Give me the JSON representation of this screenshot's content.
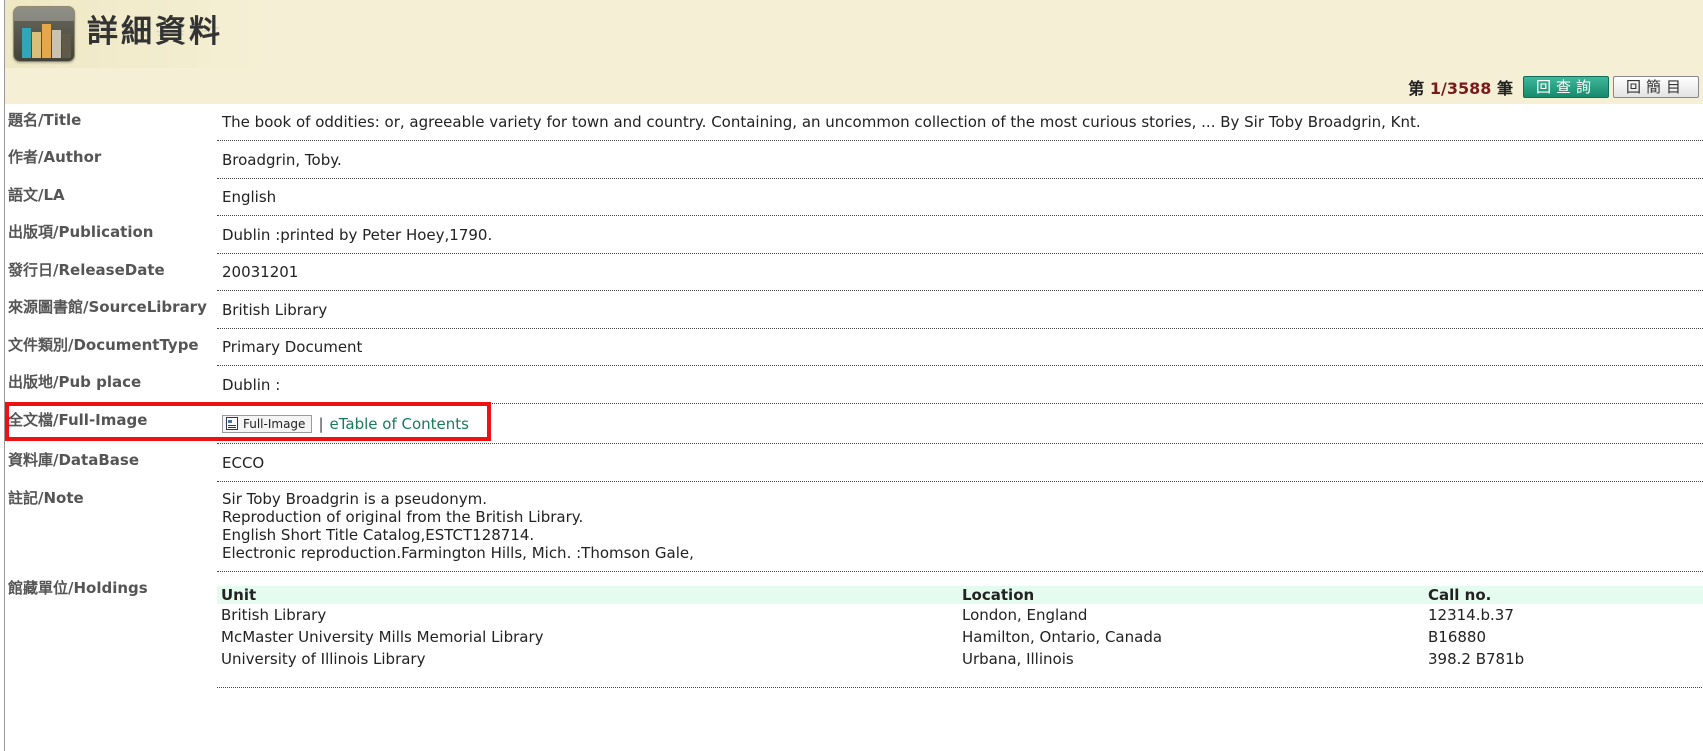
{
  "header": {
    "title": "詳細資料",
    "pager": {
      "prefix": "第",
      "current_total": "1/3588",
      "suffix": "筆"
    },
    "buttons": {
      "back_to_query": "回查詢",
      "back_to_list": "回簡目"
    }
  },
  "colors": {
    "header_bg": "#f5f0d5",
    "highlight_border": "#ee1111",
    "link": "#1b7a56",
    "table_header_bg": "#e6fbef"
  },
  "fields": {
    "title": {
      "label": "題名/Title",
      "value": "The book of oddities: or, agreeable variety for town and country. Containing, an uncommon collection of the most curious stories, ... By Sir Toby Broadgrin, Knt."
    },
    "author": {
      "label": "作者/Author",
      "value": "Broadgrin, Toby."
    },
    "language": {
      "label": "語文/LA",
      "value": "English"
    },
    "publication": {
      "label": "出版項/Publication",
      "value": "Dublin :printed by Peter Hoey,1790."
    },
    "release_date": {
      "label": "發行日/ReleaseDate",
      "value": "20031201"
    },
    "source_library": {
      "label": "來源圖書館/SourceLibrary",
      "value": "British Library"
    },
    "document_type": {
      "label": "文件類別/DocumentType",
      "value": "Primary Document"
    },
    "pub_place": {
      "label": "出版地/Pub place",
      "value": "Dublin :"
    },
    "full_image": {
      "label": "全文檔/Full-Image",
      "button": "Full-Image",
      "separator": "|",
      "link": "eTable of Contents",
      "icon": "document-icon"
    },
    "database": {
      "label": "資料庫/DataBase",
      "value": "ECCO"
    },
    "note": {
      "label": "註記/Note",
      "lines": [
        "Sir Toby Broadgrin is a pseudonym.",
        "Reproduction of original from the British Library.",
        "English Short Title Catalog,ESTCT128714.",
        "Electronic reproduction.Farmington Hills, Mich. :Thomson Gale,"
      ]
    },
    "holdings": {
      "label": "館藏單位/Holdings",
      "columns": [
        "Unit",
        "Location",
        "Call no."
      ],
      "rows": [
        [
          "British Library",
          "London, England",
          "12314.b.37"
        ],
        [
          "McMaster University Mills Memorial Library",
          "Hamilton, Ontario, Canada",
          "B16880"
        ],
        [
          "University of Illinois Library",
          "Urbana, Illinois",
          "398.2 B781b"
        ]
      ]
    }
  }
}
